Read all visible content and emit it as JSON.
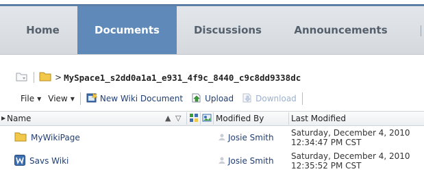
{
  "tabs": [
    {
      "label": "Home",
      "active": false
    },
    {
      "label": "Documents",
      "active": true
    },
    {
      "label": "Discussions",
      "active": false
    },
    {
      "label": "Announcements",
      "active": false
    }
  ],
  "breadcrumb": {
    "separator": ">",
    "path": "MySpace1_s2dd0a1a1_e931_4f9c_8440_c9c8dd9338dc"
  },
  "toolbar": {
    "file_label": "File",
    "view_label": "View",
    "new_wiki_label": "New Wiki Document",
    "upload_label": "Upload",
    "download_label": "Download"
  },
  "table": {
    "columns": {
      "name": "Name",
      "modified_by": "Modified By",
      "last_modified": "Last Modified"
    },
    "rows": [
      {
        "type": "folder",
        "icon": "folder-icon",
        "name": "MyWikiPage",
        "modified_by": "Josie Smith",
        "date_line1": "Saturday, December 4, 2010",
        "date_line2": "12:34:47 PM CST"
      },
      {
        "type": "wiki",
        "icon": "wiki-document-icon",
        "name": "Savs Wiki",
        "modified_by": "Josie Smith",
        "date_line1": "Saturday, December 4, 2010",
        "date_line2": "12:35:52 PM CST"
      }
    ]
  },
  "colors": {
    "active_tab": "#5f89b8",
    "link": "#1f3d73",
    "folder": "#f2c84b"
  }
}
